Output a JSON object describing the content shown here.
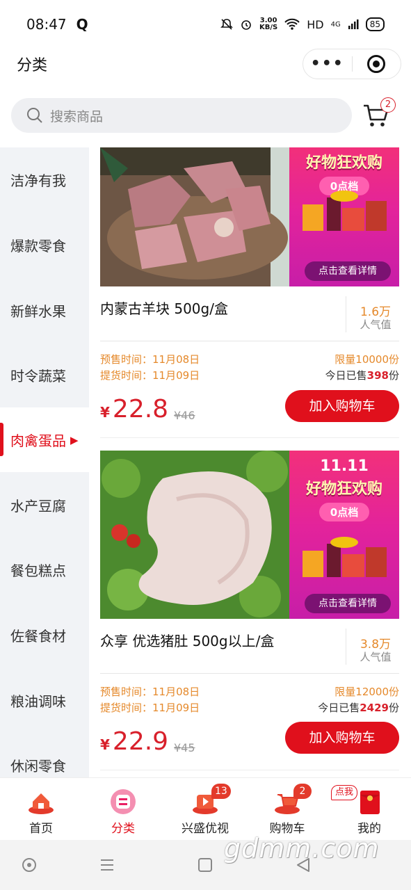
{
  "status_bar": {
    "time": "08:47",
    "app_icon": "Q",
    "speed_value": "3.00",
    "speed_unit": "KB/S",
    "network": "HD",
    "signal": "4G",
    "battery": "85"
  },
  "header": {
    "title": "分类",
    "capsule_more_icon": "more-dots-icon",
    "capsule_close_icon": "target-icon"
  },
  "search": {
    "placeholder": "搜索商品",
    "cart_badge": "2"
  },
  "sidebar": {
    "items": [
      {
        "label": "洁净有我"
      },
      {
        "label": "爆款零食"
      },
      {
        "label": "新鲜水果"
      },
      {
        "label": "时令蔬菜"
      },
      {
        "label": "肉禽蛋品",
        "active": true,
        "arrow": "▶"
      },
      {
        "label": "水产豆腐"
      },
      {
        "label": "餐包糕点"
      },
      {
        "label": "佐餐食材"
      },
      {
        "label": "粮油调味"
      },
      {
        "label": "休闲零食"
      }
    ]
  },
  "products": [
    {
      "name": "内蒙古羊块 500g/盒",
      "popularity": "1.6万",
      "popularity_label": "人气值",
      "presale_time": "预售时间：11月08日",
      "pickup_time": "提货时间：11月09日",
      "limit": "限量10000份",
      "sold_prefix": "今日已售",
      "sold_count": "398",
      "sold_suffix": "份",
      "currency": "¥",
      "price": "22.8",
      "original_price": "¥46",
      "button": "加入购物车",
      "promo": {
        "top": "",
        "title": "好物狂欢购",
        "tag": "0点档",
        "button": "点击查看详情"
      }
    },
    {
      "name": "众享 优选猪肚 500g以上/盒",
      "popularity": "3.8万",
      "popularity_label": "人气值",
      "presale_time": "预售时间：11月08日",
      "pickup_time": "提货时间：11月09日",
      "limit": "限量12000份",
      "sold_prefix": "今日已售",
      "sold_count": "2429",
      "sold_suffix": "份",
      "currency": "¥",
      "price": "22.9",
      "original_price": "¥45",
      "button": "加入购物车",
      "promo": {
        "top": "11.11",
        "title": "好物狂欢购",
        "tag": "0点档",
        "button": "点击查看详情"
      }
    }
  ],
  "tabbar": {
    "tabs": [
      {
        "label": "首页",
        "icon": "home-icon"
      },
      {
        "label": "分类",
        "icon": "category-icon",
        "active": true
      },
      {
        "label": "兴盛优视",
        "icon": "video-icon",
        "badge": "13"
      },
      {
        "label": "购物车",
        "icon": "cart-icon",
        "badge": "2"
      },
      {
        "label": "我的",
        "icon": "redpacket-icon",
        "badge": "点我"
      }
    ]
  },
  "watermark": "gdmm.com",
  "colors": {
    "accent": "#e0101c",
    "orange": "#e5892b",
    "promo_pink": "#e3239b"
  }
}
